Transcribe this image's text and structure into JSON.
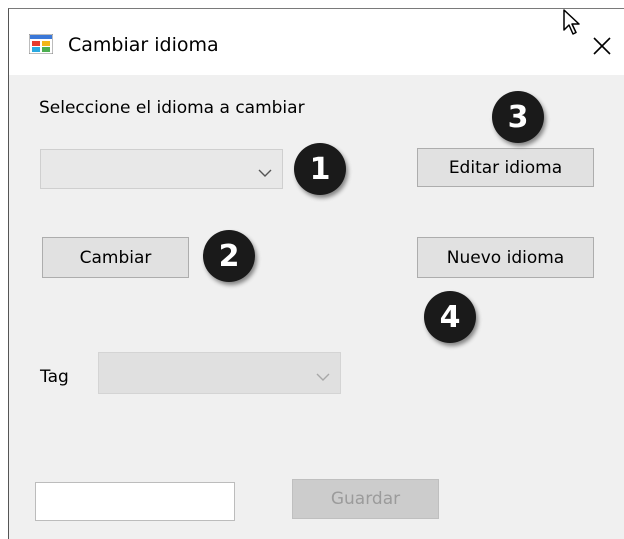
{
  "window": {
    "title": "Cambiar idioma",
    "icon": "windows-forms-app-icon",
    "close_icon": "close-icon"
  },
  "language_section": {
    "prompt_label": "Seleccione el idioma a cambiar",
    "language_combo_value": "",
    "change_button_label": "Cambiar",
    "edit_language_button_label": "Editar idioma",
    "new_language_button_label": "Nuevo idioma"
  },
  "tag_section": {
    "tag_label": "Tag",
    "tag_combo_value": ""
  },
  "footer": {
    "text_value": "",
    "save_button_label": "Guardar"
  },
  "annotations": {
    "badge_1": "1",
    "badge_2": "2",
    "badge_3": "3",
    "badge_4": "4"
  },
  "colors": {
    "window_background": "#f0f0f0",
    "titlebar_background": "#ffffff",
    "button_background": "#e1e1e1",
    "disabled_background": "#cccccc",
    "badge_background": "#1a1a1a"
  }
}
